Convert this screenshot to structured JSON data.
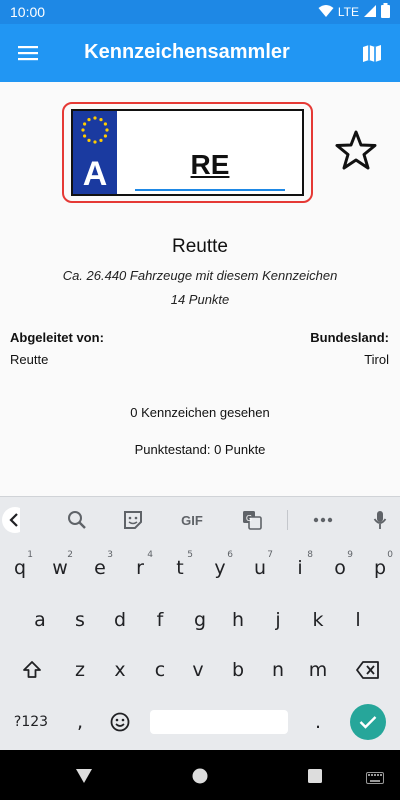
{
  "status_bar": {
    "time": "10:00",
    "network": "LTE"
  },
  "app_bar": {
    "title": "Kennzeichensammler"
  },
  "plate": {
    "country_code": "A",
    "code": "RE"
  },
  "details": {
    "city": "Reutte",
    "vehicles_text": "Ca. 26.440 Fahrzeuge mit diesem Kennzeichen",
    "points_text": "14 Punkte",
    "derived_label": "Abgeleitet von:",
    "derived_value": "Reutte",
    "state_label": "Bundesland:",
    "state_value": "Tirol",
    "seen_text": "0 Kennzeichen gesehen",
    "score_text": "Punktestand: 0 Punkte"
  },
  "keyboard_toolbar": {
    "gif_label": "GIF"
  },
  "keyboard": {
    "row1": [
      "q",
      "w",
      "e",
      "r",
      "t",
      "y",
      "u",
      "i",
      "o",
      "p"
    ],
    "row1_hints": [
      "1",
      "2",
      "3",
      "4",
      "5",
      "6",
      "7",
      "8",
      "9",
      "0"
    ],
    "row2": [
      "a",
      "s",
      "d",
      "f",
      "g",
      "h",
      "j",
      "k",
      "l"
    ],
    "row3": [
      "z",
      "x",
      "c",
      "v",
      "b",
      "n",
      "m"
    ],
    "symbols_label": "?123",
    "comma": ",",
    "period": "."
  },
  "colors": {
    "primary": "#2196f3",
    "status_bar": "#1e88e5",
    "plate_border": "#e53935",
    "eu_blue": "#1a3aa0",
    "enter": "#26a69a"
  }
}
